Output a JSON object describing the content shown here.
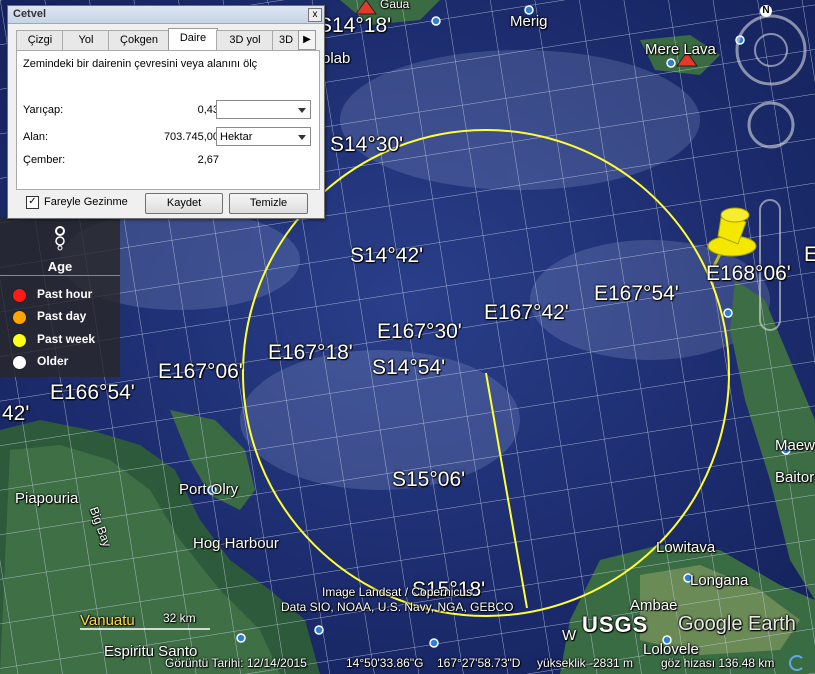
{
  "dialog": {
    "title": "Cetvel",
    "close": "x",
    "tabs": [
      "Çizgi",
      "Yol",
      "Çokgen",
      "Daire",
      "3D yol",
      "3D"
    ],
    "active_tab": "Daire",
    "description": "Zemindeki bir dairenin çevresini veya alanını ölç",
    "radius_label": "Yarıçap:",
    "radius_value": "0,43",
    "radius_unit": "",
    "area_label": "Alan:",
    "area_value": "703.745,00",
    "area_unit": "Hektar",
    "circumference_label": "Çember:",
    "circumference_value": "2,67",
    "mouse_nav_label": "Fareyle Gezinme",
    "mouse_nav_checked": true,
    "save_label": "Kaydet",
    "clear_label": "Temizle"
  },
  "legend": {
    "title": "Age",
    "items": [
      {
        "label": "Past hour",
        "color": "#ff1a1a"
      },
      {
        "label": "Past day",
        "color": "#ffa500"
      },
      {
        "label": "Past week",
        "color": "#ffff1a"
      },
      {
        "label": "Older",
        "color": "#ffffff"
      }
    ]
  },
  "map": {
    "grid_labels": [
      "S14°18'",
      "S14°30'",
      "S14°42'",
      "E167°54'",
      "E168°06'",
      "E167°42'",
      "E167°30'",
      "E167°18'",
      "S14°54'",
      "E167°06'",
      "E166°54'",
      "42'",
      "S15°06'",
      "S15°18'"
    ],
    "places": [
      "Gaua",
      "Merig",
      "Mere Lava",
      "olab",
      "Piapouria",
      "Big Bay",
      "Port Olry",
      "Hog Harbour",
      "Lowitava",
      "Longana",
      "Ambae",
      "Lolovele",
      "Maewo",
      "Baitora",
      "Vanuatu",
      "Espiritu Santo",
      "W",
      "E"
    ],
    "credits": [
      "Image Landsat / Copernicus",
      "Data SIO, NOAA, U.S. Navy, NGA, GEBCO"
    ],
    "scale": "32 km",
    "usgs": "USGS",
    "brand": "Google Earth"
  },
  "status": {
    "date": "Görüntü Tarihi: 12/14/2015",
    "lat": "14°50'33.86\"G",
    "lon": "167°27'58.73\"D",
    "elevation": "yükseklik -2831 m",
    "eye": "göz hizası 136.48 km"
  },
  "compass": {
    "north": "N"
  }
}
